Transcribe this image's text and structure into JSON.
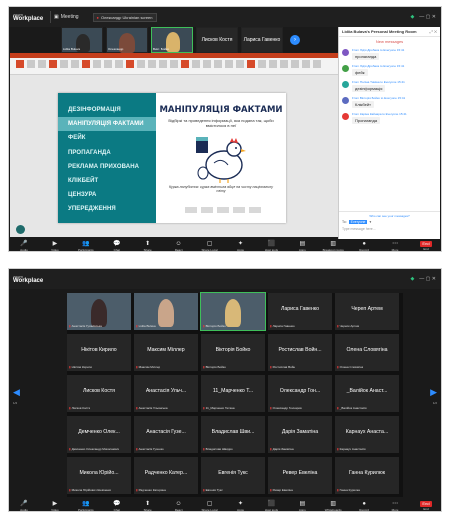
{
  "shot1": {
    "titlebar": {
      "brand_top": "zoom",
      "brand": "Workplace",
      "meeting": "Meeting",
      "tab": "Олександр Ukrainian screen",
      "recording": "Recording",
      "window_controls": "—  ▢  ✕"
    },
    "thumbs": [
      {
        "name": "Lidiia Bulava",
        "video": true
      },
      {
        "name": "Олександр",
        "video": true
      },
      {
        "name": "Викт. Бойко",
        "video": true
      },
      {
        "name": "Лисков Костя",
        "big": "Лисков Костя",
        "video": false
      },
      {
        "name": "Лариса Гавенко",
        "big": "Лариса Гавенко",
        "video": false
      }
    ],
    "slide": {
      "menu": [
        "ДЕЗІНФОРМАЦІЯ",
        "МАНІПУЛЯЦІЯ ФАКТАМИ",
        "ФЕЙК",
        "ПРОПАГАНДА",
        "РЕКЛАМА ПРИХОВАНА",
        "КЛІКБЕЙТ",
        "ЦЕНЗУРА",
        "УПЕРЕДЖЕННЯ"
      ],
      "highlighted": 1,
      "title": "МАНІПУЛЯЦІЯ ФАКТАМИ",
      "subtitle": "Відбіркі та проведення інформації, яка подана так, щоби вмістилося в неї",
      "description": "Курка-полуботок: курка вмістила яйце на чисту національну світу"
    },
    "chat": {
      "title": "Lidiia Bulava's Personal Meeting Room",
      "new_messages": "New messages",
      "messages": [
        {
          "from": "From Лідія Дробаха to Everyone 15:41",
          "text": "пропаганда",
          "color": "#7e57c2"
        },
        {
          "from": "From Лідія Дробаха to Everyone 15:41",
          "text": "фейк",
          "color": "#43a047"
        },
        {
          "from": "From Поліна Тиміна to Everyone 15:41",
          "text": "дезінформація",
          "color": "#26a69a"
        },
        {
          "from": "From Вікторія Бойко to Everyone 15:41",
          "text": "Клікбейт",
          "color": "#5c6bc0"
        },
        {
          "from": "From Каріна Кайнара to Everyone 15:41",
          "text": "Пропаганда",
          "color": "#e53935"
        }
      ],
      "who_can_see": "Who can see your messages?",
      "to_label": "To:",
      "to_value": "Everyone",
      "placeholder": "Type message here..."
    },
    "toolbar": [
      {
        "icon": "🎤",
        "label": "Audio"
      },
      {
        "icon": "▶",
        "label": "Video"
      },
      {
        "icon": "👥",
        "label": "Participants"
      },
      {
        "icon": "💬",
        "label": "Chat"
      },
      {
        "icon": "⬆",
        "label": "Share"
      },
      {
        "icon": "☺",
        "label": "React"
      },
      {
        "icon": "▢",
        "label": "Share Local"
      },
      {
        "icon": "✦",
        "label": "Apps"
      },
      {
        "icon": "⬛",
        "label": "Host tools"
      },
      {
        "icon": "▤",
        "label": "Apps"
      },
      {
        "icon": "▥",
        "label": "Breakout rooms"
      },
      {
        "icon": "●",
        "label": "Record"
      },
      {
        "icon": "⋯",
        "label": "More"
      },
      {
        "icon": "End",
        "label": "End"
      }
    ]
  },
  "shot2": {
    "titlebar": {
      "brand_top": "zoom",
      "brand": "Workplace",
      "window_controls": "—  ▢  ✕"
    },
    "tiles": [
      {
        "big": "",
        "small": "Анастасія Гусаківська",
        "video": true
      },
      {
        "big": "",
        "small": "Lidiia Bulava",
        "video": true
      },
      {
        "big": "",
        "small": "Вікторія Бойко",
        "video": true,
        "speak": true
      },
      {
        "big": "Лариса Гавенко",
        "small": "Лариса Гавенко"
      },
      {
        "big": "Череп Артем",
        "small": "Черепк Артем"
      },
      {
        "big": "Нікітов Кирило",
        "small": "Нікітов Кирило"
      },
      {
        "big": "Максим Міллер",
        "small": "Максим Міллер"
      },
      {
        "big": "Вікторія Бойко",
        "small": "Вікторія Бойко"
      },
      {
        "big": "Ростислав Войн...",
        "small": "Ростислав Войн"
      },
      {
        "big": "Олена Словягіна",
        "small": "Олена Словягіна"
      },
      {
        "big": "Лисков Костя",
        "small": "Лисков Костя"
      },
      {
        "big": "Анастасія Ульч...",
        "small": "Анастасія Ульянська"
      },
      {
        "big": "11_Марченко Т...",
        "small": "11_Марченко Тетяна"
      },
      {
        "big": "Олександр Гон...",
        "small": "Олександр Гончаров"
      },
      {
        "big": "_Валійок Анаст...",
        "small": "_Валійок Анастасія"
      },
      {
        "big": "Демченко Олек...",
        "small": "Демченко Олександр Миколаєвич"
      },
      {
        "big": "Анастасія Гузе...",
        "small": "Анастасія Гузенко"
      },
      {
        "big": "Владислав Шви...",
        "small": "Владислав Швидко"
      },
      {
        "big": "Дарія Заматіна",
        "small": "Дарія Заматіна"
      },
      {
        "big": "Карнаух Анаста...",
        "small": "Карнаух Анастасія"
      },
      {
        "big": "Микола Юрійо...",
        "small": "Микола Юрійович Шевченко"
      },
      {
        "big": "Радченко Катер...",
        "small": "Радченко Катерина"
      },
      {
        "big": "Евгенія Тукс",
        "small": "Евгенія Тукс"
      },
      {
        "big": "Ревер Евеліна",
        "small": "Ревер Евеліна"
      },
      {
        "big": "Ганна Курилюк",
        "small": "Ганна Курилюк"
      }
    ],
    "left_arrow": "◀",
    "right_arrow": "▶",
    "page_left": "1/2",
    "page_right": "1/2",
    "toolbar": [
      {
        "icon": "🎤",
        "label": "Audio"
      },
      {
        "icon": "▶",
        "label": "Video"
      },
      {
        "icon": "👥",
        "label": "Participants"
      },
      {
        "icon": "💬",
        "label": "Chat"
      },
      {
        "icon": "⬆",
        "label": "Share"
      },
      {
        "icon": "☺",
        "label": "React"
      },
      {
        "icon": "▢",
        "label": "Share Local"
      },
      {
        "icon": "✦",
        "label": "Apps"
      },
      {
        "icon": "⬛",
        "label": "Host tools"
      },
      {
        "icon": "▤",
        "label": "Apps"
      },
      {
        "icon": "▥",
        "label": "Whiteboards"
      },
      {
        "icon": "●",
        "label": "Record"
      },
      {
        "icon": "⋯",
        "label": "More"
      },
      {
        "icon": "End",
        "label": "End"
      }
    ]
  }
}
